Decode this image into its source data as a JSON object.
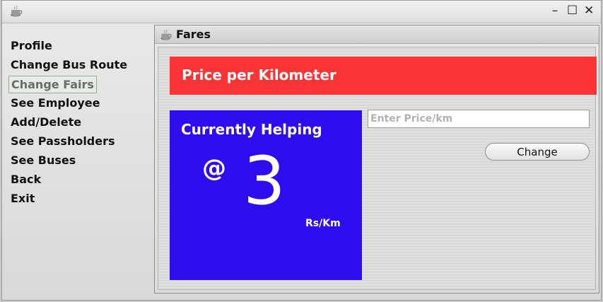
{
  "window": {
    "icon": "coffee-cup-icon",
    "controls": {
      "minimize": "–",
      "maximize": "☐",
      "close": "✕"
    }
  },
  "menu": {
    "items": [
      {
        "label": "Profile",
        "selected": false
      },
      {
        "label": "Change Bus Route",
        "selected": false
      },
      {
        "label": "Change Fairs",
        "selected": true
      },
      {
        "label": "See Employee",
        "selected": false
      },
      {
        "label": "Add/Delete",
        "selected": false
      },
      {
        "label": "See Passholders",
        "selected": false
      },
      {
        "label": "See Buses",
        "selected": false
      },
      {
        "label": "Back",
        "selected": false
      },
      {
        "label": "Exit",
        "selected": false
      }
    ]
  },
  "fares_frame": {
    "title": "Fares",
    "icon": "coffee-cup-icon",
    "banner": "Price per Kilometer",
    "banner_color": "#fb3535",
    "panel_color": "#2f0bf0",
    "currently_label": "Currently Helping",
    "at_symbol": "@",
    "current_price": "3",
    "unit": "Rs/Km",
    "input": {
      "value": "",
      "placeholder": "Enter Price/km"
    },
    "change_button": "Change"
  }
}
